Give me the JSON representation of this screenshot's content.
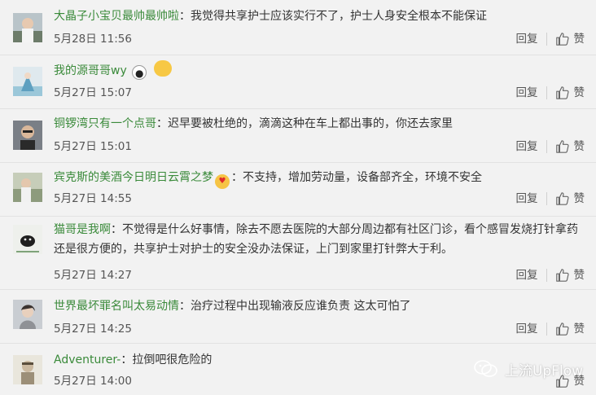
{
  "reply_label": "回复",
  "like_label": "赞",
  "comments": [
    {
      "user": "大晶子小宝贝最帅最帅啦",
      "text": "：我觉得共享护士应该实行不了，护士人身安全根本不能保证",
      "time": "5月28日 11:56"
    },
    {
      "user": "我的源哥哥wy",
      "text": "",
      "time": "5月27日 15:07"
    },
    {
      "user": "铜锣湾只有一个点哥",
      "text": "：迟早要被杜绝的，滴滴这种在车上都出事的，你还去家里",
      "time": "5月27日 15:01"
    },
    {
      "user": "宾克斯的美酒今日明日云霄之梦",
      "text": "：不支持，增加劳动量，设备部齐全，环境不安全",
      "time": "5月27日 14:55"
    },
    {
      "user": "猫哥是我啊",
      "text": "：不觉得是什么好事情，除去不愿去医院的大部分周边都有社区门诊，看个感冒发烧打针拿药还是很方便的，共享护士对护士的安全没办法保证，上门到家里打针弊大于利。",
      "time": "5月27日 14:27"
    },
    {
      "user": "世界最坏罪名叫太易动情",
      "text": "：治疗过程中出现输液反应谁负责 这太可怕了",
      "time": "5月27日 14:25"
    },
    {
      "user": "Adventurer-",
      "text": "：拉倒吧很危险的",
      "time": "5月27日 14:00"
    }
  ],
  "watermark": "上流UpFlow",
  "colors": {
    "username": "#3a8a3a",
    "text": "#333333",
    "meta": "#555555",
    "background": "#f2f2f2"
  }
}
